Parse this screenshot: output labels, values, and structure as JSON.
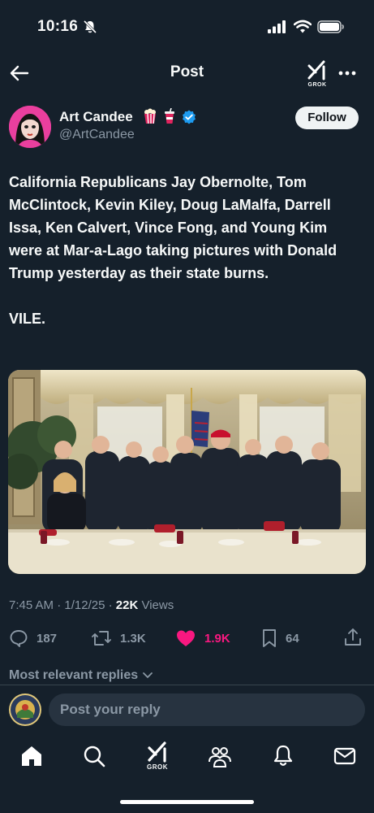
{
  "status_bar": {
    "time": "10:16"
  },
  "header": {
    "title": "Post",
    "grok_label": "GROK"
  },
  "author": {
    "name": "Art Candee",
    "handle": "@ArtCandee",
    "follow_label": "Follow"
  },
  "tweet": {
    "text": "California Republicans Jay Obernolte, Tom McClintock, Kevin Kiley, Doug LaMalfa, Darrell Issa, Ken Calvert, Vince Fong, and Young Kim were at Mar-a-Lago taking pictures with Donald Trump yesterday as their state burns.\n\nVILE."
  },
  "meta": {
    "time": "7:45 AM",
    "date": "1/12/25",
    "views_count": "22K",
    "views_label": "Views",
    "sep": "·"
  },
  "actions": {
    "replies": "187",
    "reposts": "1.3K",
    "likes": "1.9K",
    "bookmarks": "64"
  },
  "replies_sort": "Most relevant replies",
  "reply_placeholder": "Post your reply",
  "bottom_nav": {
    "grok_label": "GROK"
  },
  "colors": {
    "background": "#15202b",
    "like": "#f91880",
    "verified": "#1d9bf0",
    "muted": "#8b98a5"
  }
}
